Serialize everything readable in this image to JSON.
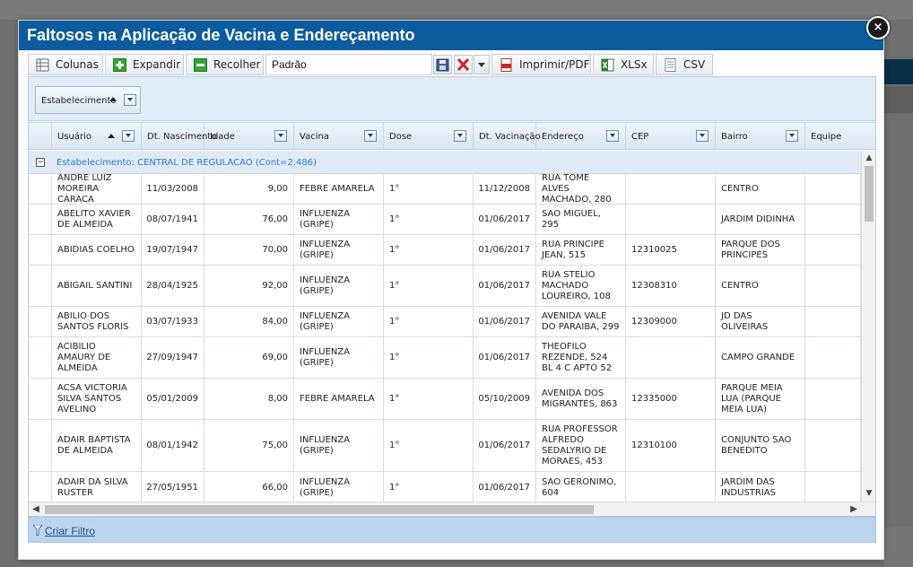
{
  "modal": {
    "title": "Faltosos na Aplicação de Vacina e Endereçamento",
    "close_label": "×"
  },
  "toolbar": {
    "columns_label": "Colunas",
    "expand_label": "Expandir",
    "collapse_label": "Recolher",
    "view_value": "Padrão",
    "pdf_label": "Imprimir/PDF",
    "xlsx_label": "XLSx",
    "csv_label": "CSV"
  },
  "group_bar": {
    "chip_label": "Estabelecimento"
  },
  "grid": {
    "columns": [
      {
        "key": "usuario",
        "label": "Usuário"
      },
      {
        "key": "nascimento",
        "label": "Dt. Nascimento"
      },
      {
        "key": "idade",
        "label": "Idade"
      },
      {
        "key": "vacina",
        "label": "Vacina"
      },
      {
        "key": "dose",
        "label": "Dose"
      },
      {
        "key": "vacinacao",
        "label": "Dt. Vacinação"
      },
      {
        "key": "endereco",
        "label": "Endereço"
      },
      {
        "key": "cep",
        "label": "CEP"
      },
      {
        "key": "bairro",
        "label": "Bairro"
      },
      {
        "key": "equipe",
        "label": "Equipe"
      }
    ],
    "group_label": "Estabelecimento: CENTRAL DE REGULACAO (Cont=2.486)",
    "rows": [
      {
        "usuario": "ANDRE LUIZ MOREIRA CARACA",
        "nascimento": "11/03/2008",
        "idade": "9,00",
        "vacina": "FEBRE AMARELA",
        "dose": "1°",
        "vacinacao": "11/12/2008",
        "endereco": "RUA TOME ALVES MACHADO, 280",
        "cep": "",
        "bairro": "CENTRO",
        "equipe": ""
      },
      {
        "usuario": "ABELITO XAVIER DE ALMEIDA",
        "nascimento": "08/07/1941",
        "idade": "76,00",
        "vacina": "INFLUENZA (GRIPE)",
        "dose": "1°",
        "vacinacao": "01/06/2017",
        "endereco": "SAO MIGUEL, 295",
        "cep": "",
        "bairro": "JARDIM DIDINHA",
        "equipe": ""
      },
      {
        "usuario": "ABIDIAS COELHO",
        "nascimento": "19/07/1947",
        "idade": "70,00",
        "vacina": "INFLUENZA (GRIPE)",
        "dose": "1°",
        "vacinacao": "01/06/2017",
        "endereco": "RUA PRINCIPE JEAN, 515",
        "cep": "12310025",
        "bairro": "PARQUE DOS PRINCIPES",
        "equipe": ""
      },
      {
        "usuario": "ABIGAIL SANTINI",
        "nascimento": "28/04/1925",
        "idade": "92,00",
        "vacina": "INFLUENZA (GRIPE)",
        "dose": "1°",
        "vacinacao": "01/06/2017",
        "endereco": "RUA STELIO MACHADO LOUREIRO, 108",
        "cep": "12308310",
        "bairro": "CENTRO",
        "equipe": ""
      },
      {
        "usuario": "ABILIO DOS SANTOS FLORIS",
        "nascimento": "03/07/1933",
        "idade": "84,00",
        "vacina": "INFLUENZA (GRIPE)",
        "dose": "1°",
        "vacinacao": "01/06/2017",
        "endereco": "AVENIDA VALE DO PARAIBA, 299",
        "cep": "12309000",
        "bairro": "JD DAS OLIVEIRAS",
        "equipe": ""
      },
      {
        "usuario": "ACIBILIO AMAURY DE ALMEIDA",
        "nascimento": "27/09/1947",
        "idade": "69,00",
        "vacina": "INFLUENZA (GRIPE)",
        "dose": "1°",
        "vacinacao": "01/06/2017",
        "endereco": "THEOFILO REZENDE, 524 BL 4 C APTO 52",
        "cep": "",
        "bairro": "CAMPO GRANDE",
        "equipe": ""
      },
      {
        "usuario": "ACSA VICTORIA SILVA SANTOS AVELINO",
        "nascimento": "05/01/2009",
        "idade": "8,00",
        "vacina": "FEBRE AMARELA",
        "dose": "1°",
        "vacinacao": "05/10/2009",
        "endereco": "AVENIDA DOS MIGRANTES, 863",
        "cep": "12335000",
        "bairro": "PARQUE MEIA LUA (PARQUE MEIA LUA)",
        "equipe": ""
      },
      {
        "usuario": "ADAIR BAPTISTA DE ALMEIDA",
        "nascimento": "08/01/1942",
        "idade": "75,00",
        "vacina": "INFLUENZA (GRIPE)",
        "dose": "1°",
        "vacinacao": "01/06/2017",
        "endereco": "RUA PROFESSOR ALFREDO SEDALYRIO DE MORAES, 453",
        "cep": "12310100",
        "bairro": "CONJUNTO SAO BENEDITO",
        "equipe": ""
      },
      {
        "usuario": "ADAIR DA SILVA RUSTER",
        "nascimento": "27/05/1951",
        "idade": "66,00",
        "vacina": "INFLUENZA (GRIPE)",
        "dose": "1°",
        "vacinacao": "01/06/2017",
        "endereco": "SAO GERONIMO, 604",
        "cep": "",
        "bairro": "JARDIM DAS INDUSTRIAS",
        "equipe": ""
      }
    ]
  },
  "footer": {
    "create_filter_label": "Criar Filtro"
  },
  "colors": {
    "header_blue": "#0c5b9c",
    "group_text": "#2a7fc6",
    "footer_bg": "#bcd5ef"
  }
}
